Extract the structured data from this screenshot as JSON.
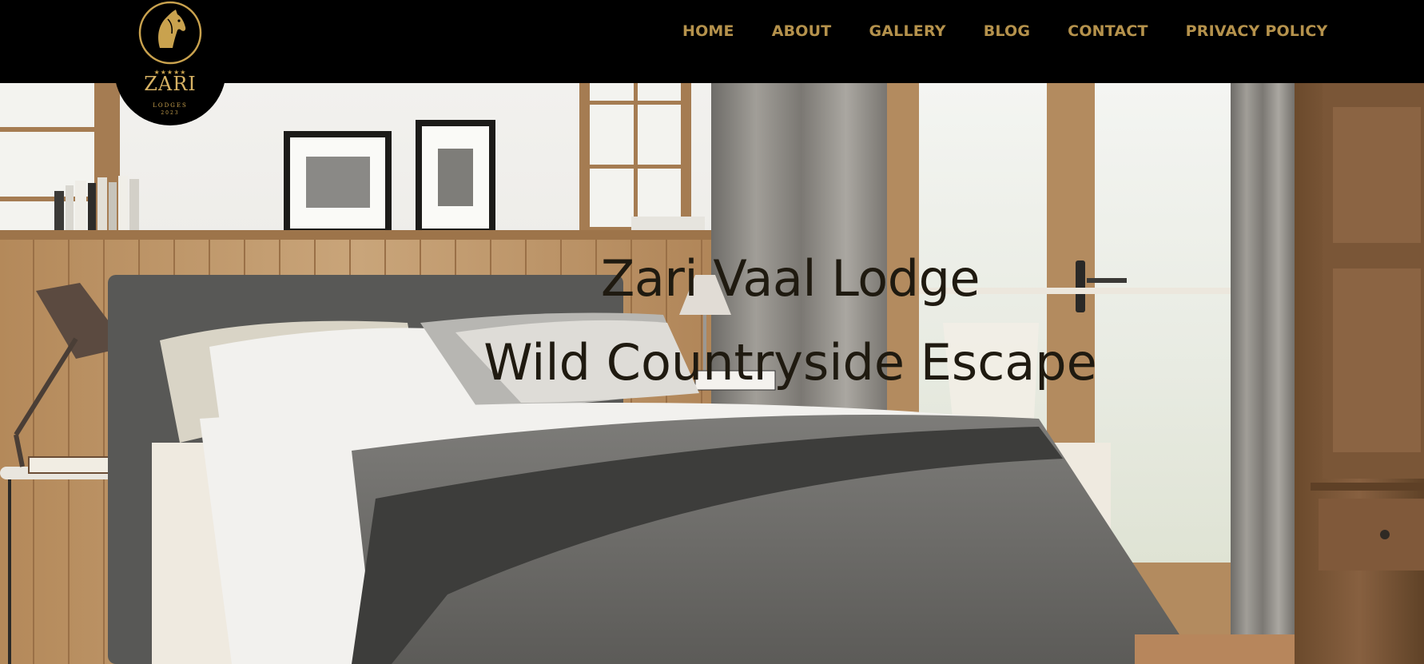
{
  "brand": {
    "name": "ZARI",
    "sub": "LODGES",
    "year": "2023",
    "stars": "★★★★★",
    "logo_icon": "horse-head-icon"
  },
  "nav": {
    "items": [
      {
        "label": "HOME"
      },
      {
        "label": "ABOUT"
      },
      {
        "label": "GALLERY"
      },
      {
        "label": "BLOG"
      },
      {
        "label": "CONTACT"
      },
      {
        "label": "PRIVACY POLICY"
      }
    ]
  },
  "hero": {
    "title": "Zari Vaal Lodge",
    "subtitle": "Wild Countryside Escape"
  },
  "colors": {
    "header_bg": "#000000",
    "nav_text": "#b5924c",
    "hero_text": "#1f1a10"
  }
}
